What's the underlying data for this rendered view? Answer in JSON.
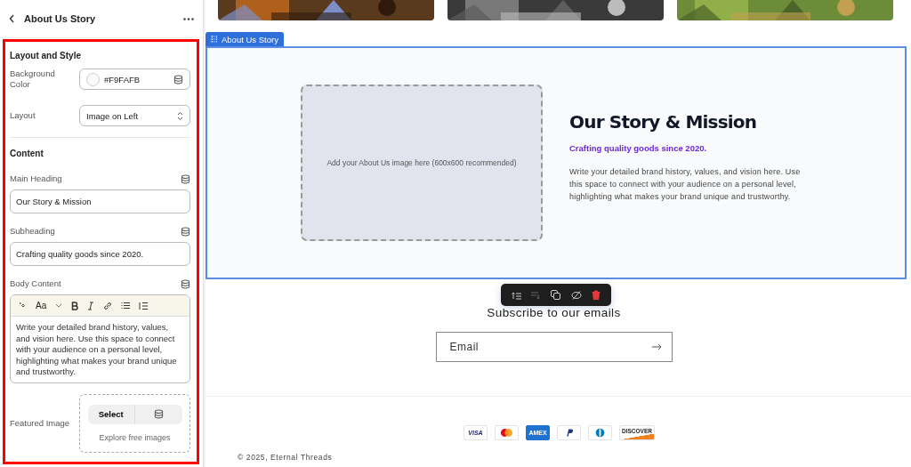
{
  "header": {
    "title": "About Us Story"
  },
  "layout_section": {
    "heading": "Layout and Style",
    "background_color": {
      "label": "Background Color",
      "value": "#F9FAFB"
    },
    "layout": {
      "label": "Layout",
      "value": "Image on Left"
    }
  },
  "content_section": {
    "heading": "Content",
    "main_heading": {
      "label": "Main Heading",
      "value": "Our Story & Mission"
    },
    "subheading": {
      "label": "Subheading",
      "value": "Crafting quality goods since 2020."
    },
    "body": {
      "label": "Body Content",
      "font_button": "Aa",
      "value": "Write your detailed brand history, values, and vision here. Use this space to connect with your audience on a personal level, highlighting what makes your brand unique and trustworthy."
    },
    "featured_image": {
      "label": "Featured Image",
      "button": "Select",
      "link": "Explore free images"
    }
  },
  "preview": {
    "section_tag": "About Us Story",
    "image_placeholder": "Add your About Us image here (600x600 recommended)",
    "heading": "Our Story & Mission",
    "subheading": "Crafting quality goods since 2020.",
    "body": "Write your detailed brand history, values, and vision here. Use this space to connect with your audience on a personal level, highlighting what makes your brand unique and trustworthy.",
    "subscribe": {
      "heading": "Subscribe to our emails",
      "placeholder": "Email"
    },
    "payment_methods": [
      {
        "kind": "visa",
        "label": "VISA"
      },
      {
        "kind": "mastercard"
      },
      {
        "kind": "amex",
        "label": "AMEX"
      },
      {
        "kind": "paypal"
      },
      {
        "kind": "diners"
      },
      {
        "kind": "discover",
        "label": "DISCOVER"
      }
    ],
    "copyright": "© 2025, Eternal Threads"
  }
}
